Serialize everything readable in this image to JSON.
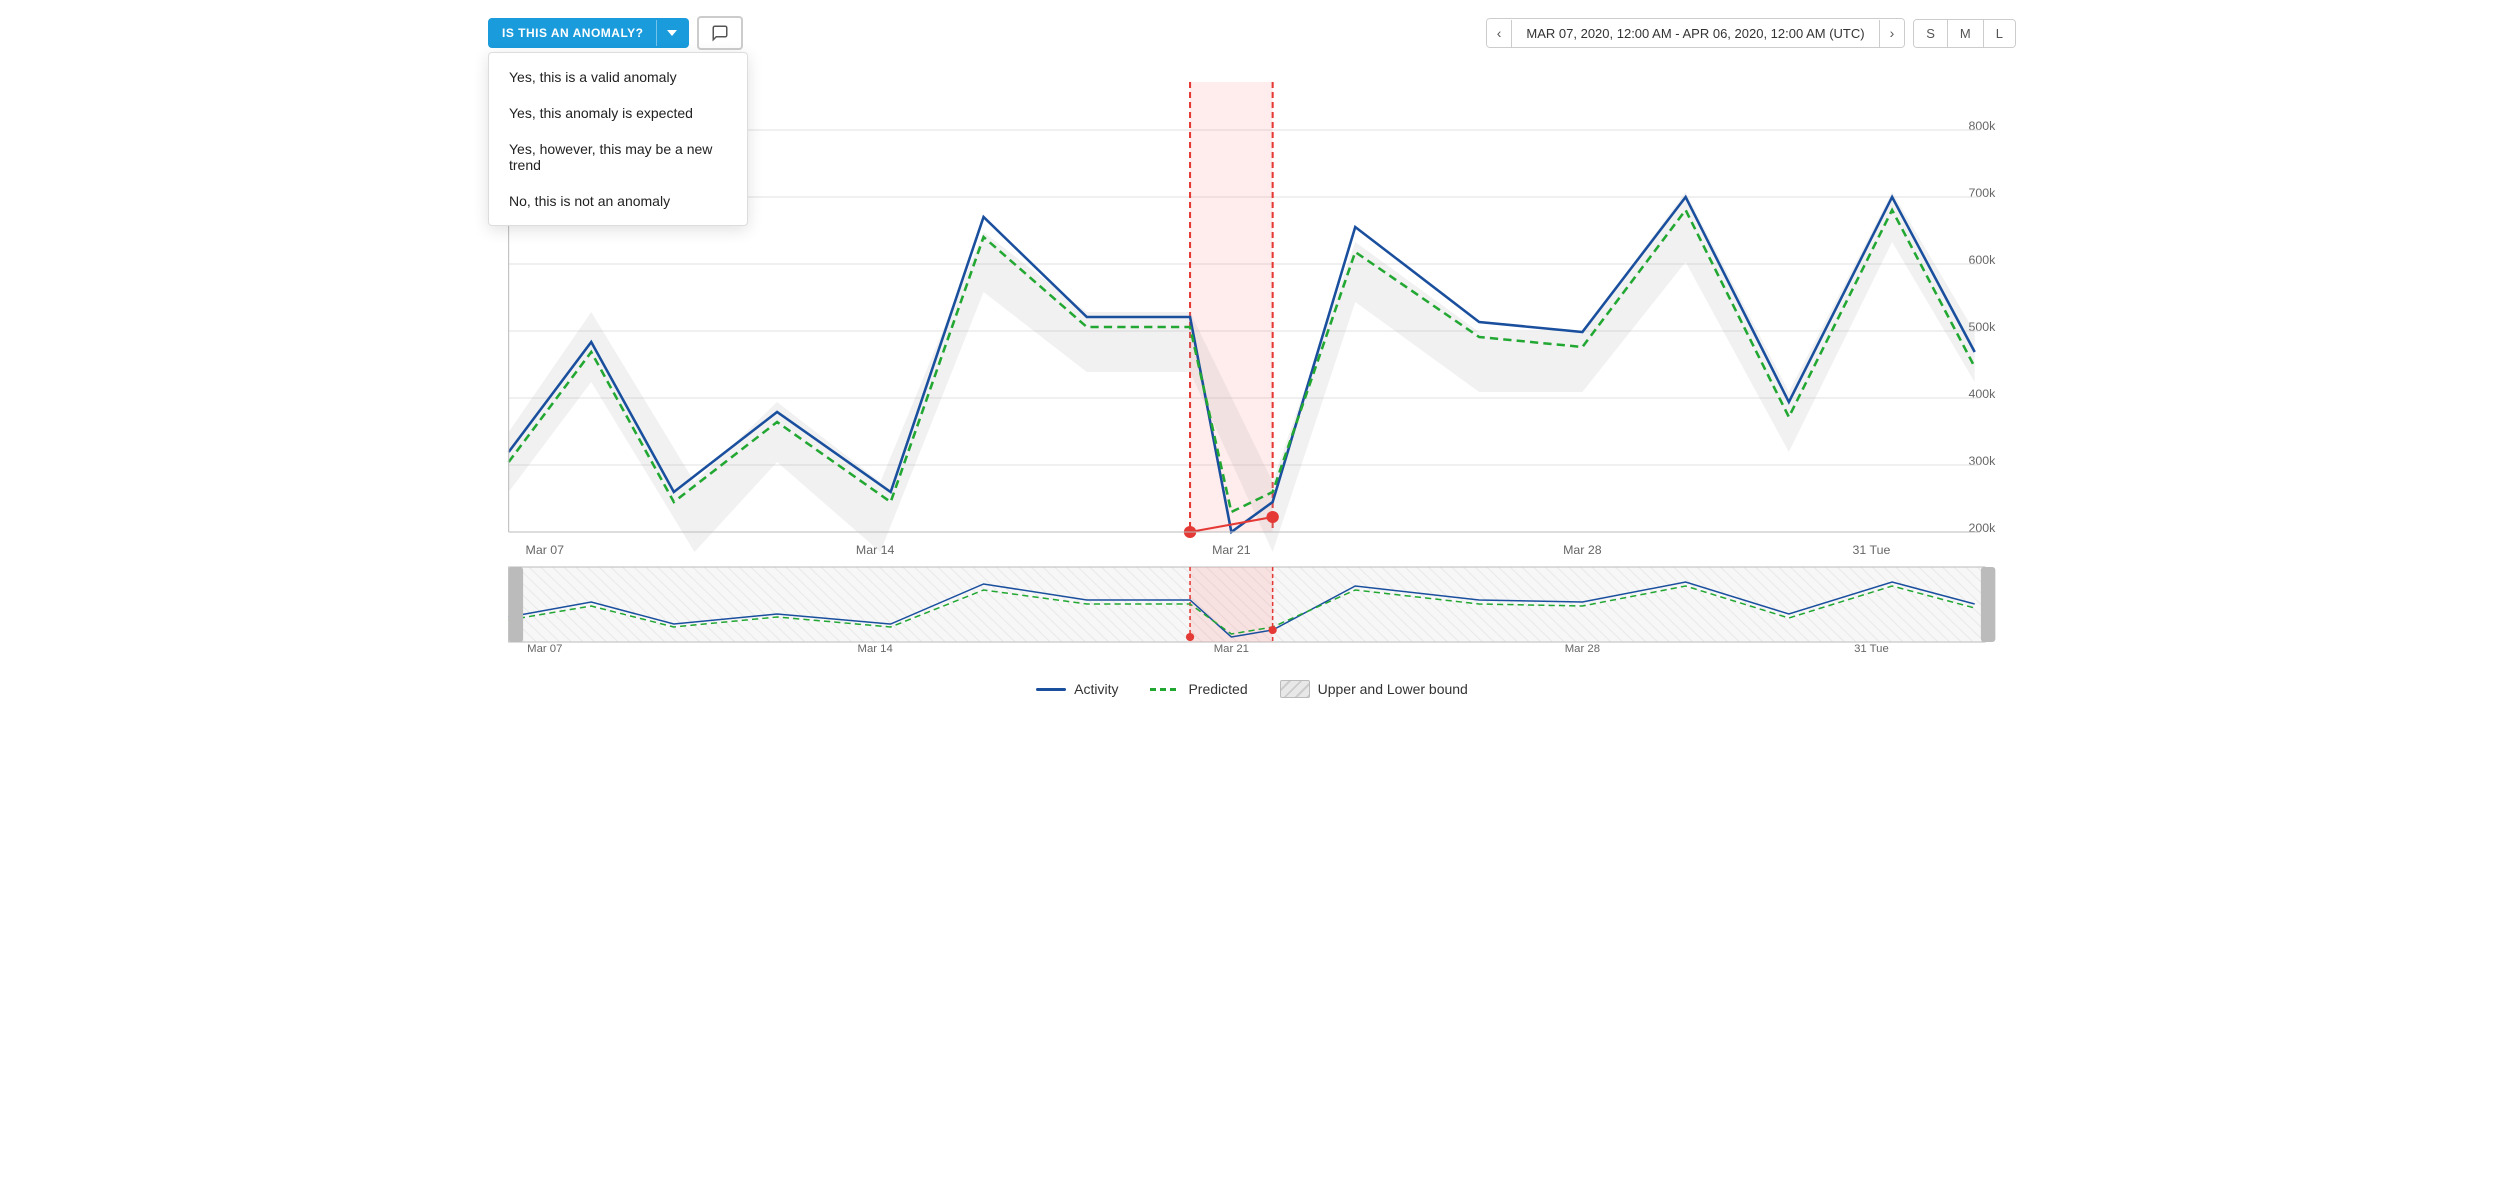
{
  "header": {
    "anomaly_label": "IS THIS AN ANOMALY?",
    "dropdown_options": [
      "Yes, this is a valid anomaly",
      "Yes, this anomaly is expected",
      "Yes, however, this may be a new trend",
      "No, this is not an anomaly"
    ],
    "date_range": "MAR 07, 2020, 12:00 AM - APR 06, 2020, 12:00 AM (UTC)",
    "size_buttons": [
      "S",
      "M",
      "L"
    ]
  },
  "chart": {
    "x_labels": [
      "Mar 07",
      "Mar 14",
      "Mar 21",
      "Mar 28",
      "31 Tue"
    ],
    "y_labels": [
      "800k",
      "700k",
      "600k",
      "500k",
      "400k",
      "300k",
      "200k"
    ],
    "anomaly_region_label": "Mar 21",
    "colors": {
      "activity": "#1a4f9e",
      "predicted": "#22a832",
      "anomaly_fill": "rgba(255,100,100,0.15)",
      "anomaly_dots": "#e53935",
      "bound_fill": "rgba(180,180,180,0.25)"
    }
  },
  "legend": {
    "activity_label": "Activity",
    "predicted_label": "Predicted",
    "bound_label": "Upper and Lower bound"
  }
}
